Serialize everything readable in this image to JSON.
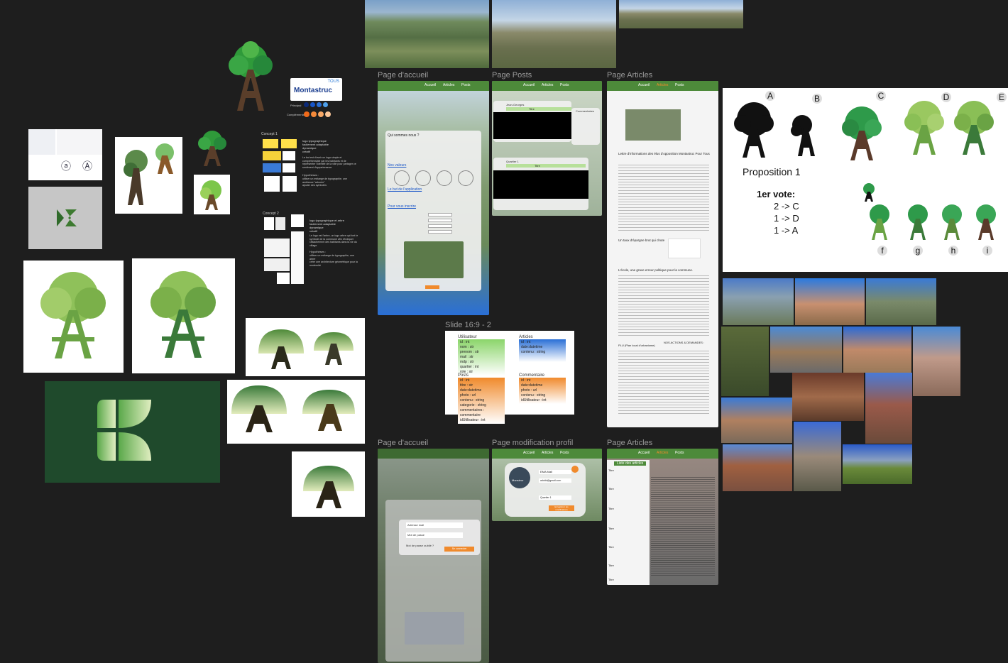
{
  "frames": {
    "accueil_1": "Page d'accueil",
    "posts": "Page Posts",
    "articles_1": "Page Articles",
    "slide": "Slide 16:9 - 2",
    "accueil_2": "Page d'accueil",
    "profil": "Page modification profil",
    "articles_2": "Page Articles"
  },
  "nav": {
    "accueil": "Accueil",
    "articles": "Articles",
    "posts": "Posts"
  },
  "logo_badge": {
    "title": "Montastruc",
    "sub": "TOUS",
    "principal": "Principal",
    "complementaire": "Complémentaire"
  },
  "concept1": {
    "title": "Concept 1",
    "bullets": [
      "logo typographique",
      "facilement adaptable",
      "dynamique",
      "créatif"
    ],
    "para": "Le but est d'avoir un logo simple et compréhensible par les habitants et de représenter l'identité de la ville pour partager ce sentiment d'appartenance.",
    "hyp_title": "Hypothèses :",
    "hyp": [
      "utiliser un mélange de typographie, une ambiance \"arborée\"",
      "ajouter des symboles"
    ]
  },
  "concept2": {
    "title": "Concept 2",
    "bullets": [
      "logo typographique et arbre",
      "facilement adaptable",
      "dynamique",
      "créatif"
    ],
    "para": "Le logo est l'arbre, un logo arbre qui font le symbole de la commune afin d'indiquer l'attachement des habitants dans la vie du village.",
    "hyp_title": "Hypothèses :",
    "hyp": [
      "utiliser un mélange de typographie, une arbre",
      "créer une architecture géométrique pour la modernité"
    ]
  },
  "accueil": {
    "qui": "Qui sommes nous ?",
    "valeurs": "Nos valeurs",
    "but": "Le but de l'application",
    "inscrire": "Pour vous inscrire",
    "login_mail": "Adresse mail",
    "login_pwd": "Mot de passe",
    "forgot": "Mot de passe oublié ?",
    "connect": "Se connecter"
  },
  "posts": {
    "title1": "Titre",
    "title2": "Titre",
    "user1": "Jean-Georges",
    "user2": "Quartier 1",
    "comments": "Commentaires"
  },
  "articles": {
    "headline": "Lettre d'informations des élus d'opposition Montastruc Pour Tous",
    "s1": "Un taux d'épargne brut qui chute",
    "s2": "L'école, une grave erreur politique pour la commune.",
    "plu": "PLU (Plan local d'urbanisme)",
    "actions": "NOS ACTIONS & DEMANDES :",
    "list_title": "Liste des articles",
    "list_items": [
      "Titre",
      "Titre",
      "Titre",
      "Titre",
      "Titre",
      "Titre",
      "Titre"
    ]
  },
  "slide": {
    "utilisateur": {
      "title": "Utilisateur",
      "fields": [
        "id : int",
        "nom : str",
        "prenom : str",
        "mail : str",
        "mdp : str",
        "quartier : int",
        "role : str"
      ]
    },
    "articles": {
      "title": "Articles",
      "fields": [
        "id : int",
        "date:datetime",
        "contenu : string"
      ]
    },
    "posts": {
      "title": "Posts",
      "fields": [
        "id : int",
        "titre : str",
        "date:datetime",
        "photo : url",
        "contenu : string",
        "categorie : string",
        "commentaires : commentaire",
        "idUtilisateur : int"
      ]
    },
    "commentaire": {
      "title": "Commentaire",
      "fields": [
        "id : int",
        "date:datetime",
        "photo : url",
        "contenu : string",
        "idUtilisateur : int"
      ]
    }
  },
  "profil": {
    "name": "Monsieur",
    "mail": "EMA Mail",
    "email": "adddd@gmail.com",
    "quartier": "Quartier 1",
    "save": "Enregistrer les modifications"
  },
  "vote": {
    "letters": [
      "A",
      "B",
      "C",
      "D",
      "E"
    ],
    "proposition": "Proposition 1",
    "vote_title": "1er vote:",
    "votes": [
      "2 -> C",
      "1 -> D",
      "1 -> A"
    ],
    "sub_letters": [
      "f",
      "g",
      "h",
      "i"
    ]
  },
  "colors": {
    "canvas": "#1e1e1e",
    "green_dark": "#1f4a2c",
    "green_nav": "#4d8a3a",
    "orange": "#f08a2c",
    "blue": "#2a6fd6"
  }
}
